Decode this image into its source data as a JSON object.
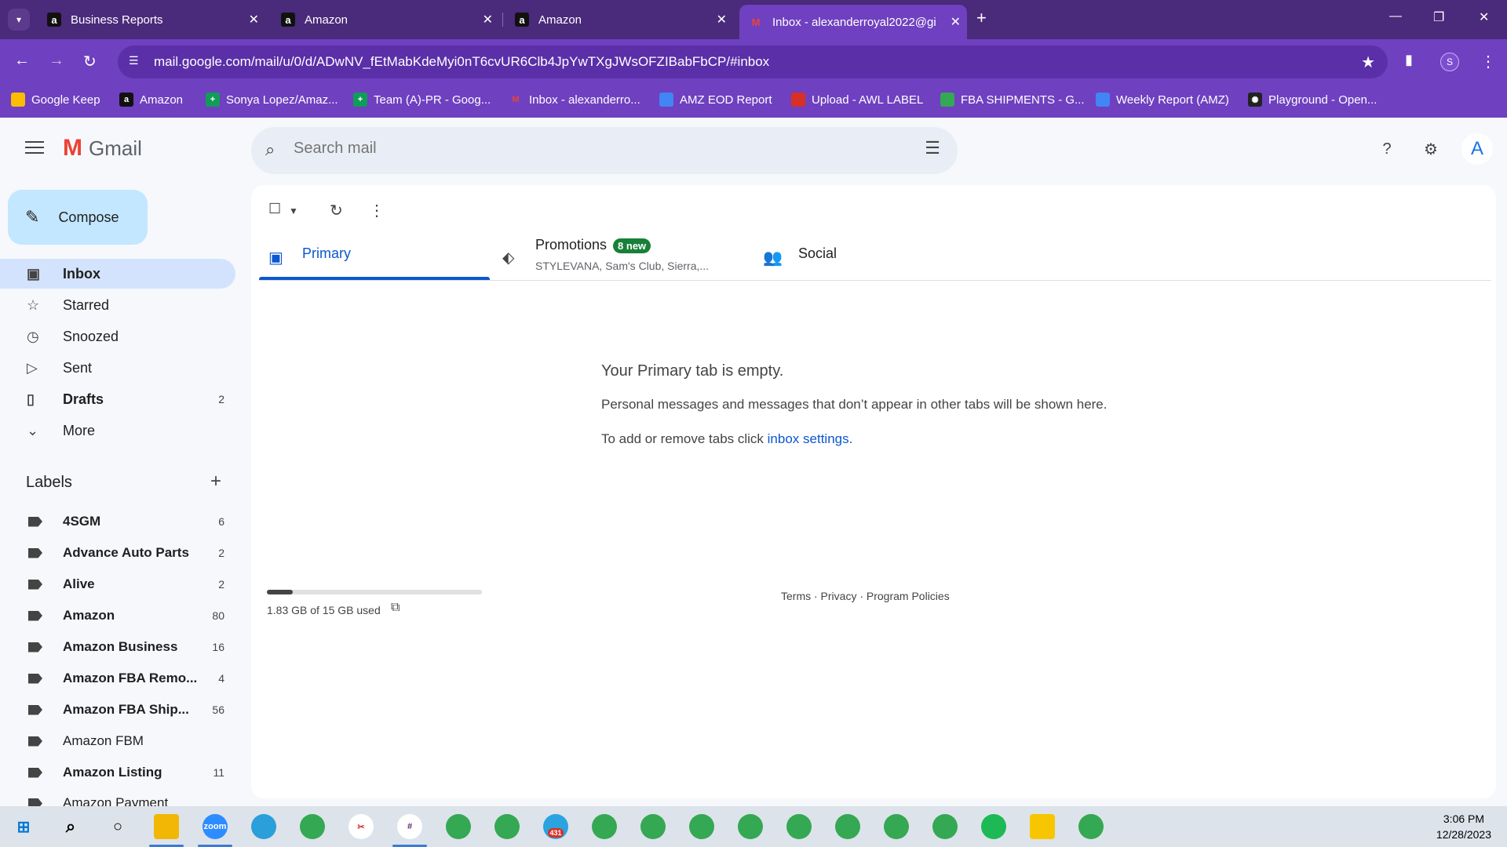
{
  "browser": {
    "tabs": [
      {
        "title": "Business Reports",
        "favicon": "amazon-icon",
        "active": false
      },
      {
        "title": "Amazon",
        "favicon": "amazon-icon",
        "active": false
      },
      {
        "title": "Amazon",
        "favicon": "amazon-icon",
        "active": false
      },
      {
        "title": "Inbox - alexanderroyal2022@gi",
        "favicon": "gmail-icon",
        "active": true
      }
    ],
    "url": "mail.google.com/mail/u/0/d/ADwNV_fEtMabKdeMyi0nT6cvUR6Clb4JpYwTXgJWsOFZIBabFbCP/#inbox",
    "profile_initial": "S",
    "bookmarks": [
      {
        "label": "Google Keep",
        "icon": "keep-icon",
        "color": "#fbbc04"
      },
      {
        "label": "Amazon",
        "icon": "amazon-icon",
        "color": "#111111"
      },
      {
        "label": "Sonya Lopez/Amaz...",
        "icon": "sheets-icon",
        "color": "#0f9d58"
      },
      {
        "label": "Team (A)-PR - Goog...",
        "icon": "sheets-icon",
        "color": "#0f9d58"
      },
      {
        "label": "Inbox - alexanderro...",
        "icon": "gmail-icon",
        "color": "#ffffff"
      },
      {
        "label": "AMZ EOD Report",
        "icon": "report-icon",
        "color": "#4285f4"
      },
      {
        "label": "Upload - AWL LABEL",
        "icon": "upload-icon",
        "color": "#d93025"
      },
      {
        "label": "FBA SHIPMENTS - G...",
        "icon": "drive-icon",
        "color": "#34a853"
      },
      {
        "label": "Weekly Report (AMZ)",
        "icon": "report-icon",
        "color": "#4285f4"
      },
      {
        "label": "Playground - Open...",
        "icon": "openai-icon",
        "color": "#222222"
      }
    ]
  },
  "gmail": {
    "brand": "Gmail",
    "search_placeholder": "Search mail",
    "compose": "Compose",
    "nav": [
      {
        "label": "Inbox",
        "icon": "inbox-icon",
        "count": "",
        "active": true
      },
      {
        "label": "Starred",
        "icon": "star-icon",
        "count": "",
        "active": false
      },
      {
        "label": "Snoozed",
        "icon": "clock-icon",
        "count": "",
        "active": false
      },
      {
        "label": "Sent",
        "icon": "send-icon",
        "count": "",
        "active": false
      },
      {
        "label": "Drafts",
        "icon": "draft-icon",
        "count": "2",
        "active": false
      },
      {
        "label": "More",
        "icon": "chevron-down-icon",
        "count": "",
        "active": false
      }
    ],
    "labels_heading": "Labels",
    "labels": [
      {
        "label": "4SGM",
        "count": "6",
        "bold": true
      },
      {
        "label": "Advance Auto Parts",
        "count": "2",
        "bold": true
      },
      {
        "label": "Alive",
        "count": "2",
        "bold": true
      },
      {
        "label": "Amazon",
        "count": "80",
        "bold": true
      },
      {
        "label": "Amazon Business",
        "count": "16",
        "bold": true
      },
      {
        "label": "Amazon FBA Remo...",
        "count": "4",
        "bold": true
      },
      {
        "label": "Amazon FBA Ship...",
        "count": "56",
        "bold": true
      },
      {
        "label": "Amazon FBM",
        "count": "",
        "bold": false
      },
      {
        "label": "Amazon Listing",
        "count": "11",
        "bold": true
      },
      {
        "label": "Amazon Payment",
        "count": "",
        "bold": false
      }
    ],
    "tabs": {
      "primary": "Primary",
      "promotions": "Promotions",
      "promotions_badge": "8 new",
      "promotions_preview": "STYLEVANA, Sam's Club, Sierra,...",
      "social": "Social"
    },
    "empty": {
      "title": "Your Primary tab is empty.",
      "text": "Personal messages and messages that don’t appear in other tabs will be shown here.",
      "text2_prefix": "To add or remove tabs click ",
      "text2_link": "inbox settings",
      "text2_suffix": "."
    },
    "storage": {
      "text": "1.83 GB of 15 GB used",
      "used_fraction": 0.122
    },
    "footer": "Terms · Privacy · Program Policies"
  },
  "taskbar": {
    "time": "3:06 PM",
    "date": "12/28/2023",
    "telegram_badge": "431"
  },
  "colors": {
    "accent": "#0b57d0",
    "chrome_purple": "#6f40c0",
    "compose_bg": "#c2e7ff",
    "active_nav": "#d3e3fd"
  }
}
